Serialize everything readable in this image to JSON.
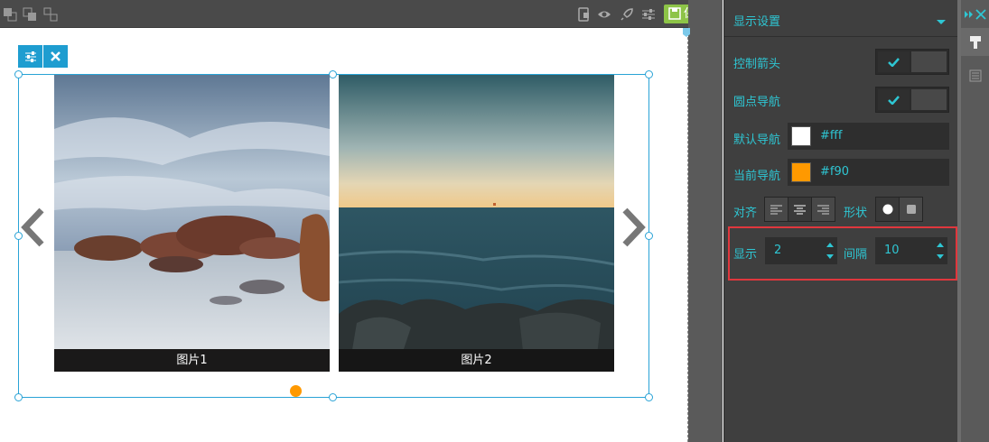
{
  "toolbar": {
    "save_label": "保存",
    "left_icons": [
      "layers-front-icon",
      "layers-back-icon",
      "layers-group-icon"
    ],
    "right_icons": [
      "mobile-preview-icon",
      "eye-icon",
      "rocket-icon",
      "sliders-icon"
    ]
  },
  "editor": {
    "tools": [
      "sliders-icon",
      "close-icon"
    ],
    "slides": [
      {
        "caption": "图片1"
      },
      {
        "caption": "图片2"
      }
    ],
    "nav_dot_color": "#f90"
  },
  "panel": {
    "title": "显示设置",
    "rows": {
      "arrows_label": "控制箭头",
      "dots_label": "圆点导航",
      "default_nav_label": "默认导航",
      "default_nav_value": "#fff",
      "current_nav_label": "当前导航",
      "current_nav_value": "#f90",
      "align_label": "对齐",
      "shape_label": "形状",
      "display_label": "显示",
      "display_value": "2",
      "spacing_label": "间隔",
      "spacing_value": "10"
    },
    "accent": "#2ec6d3",
    "highlight_color": "#e0373d"
  },
  "sidebar": {
    "icons": [
      "expand-arrows-icon",
      "close-icon",
      "paint-brush-icon",
      "list-icon"
    ]
  }
}
